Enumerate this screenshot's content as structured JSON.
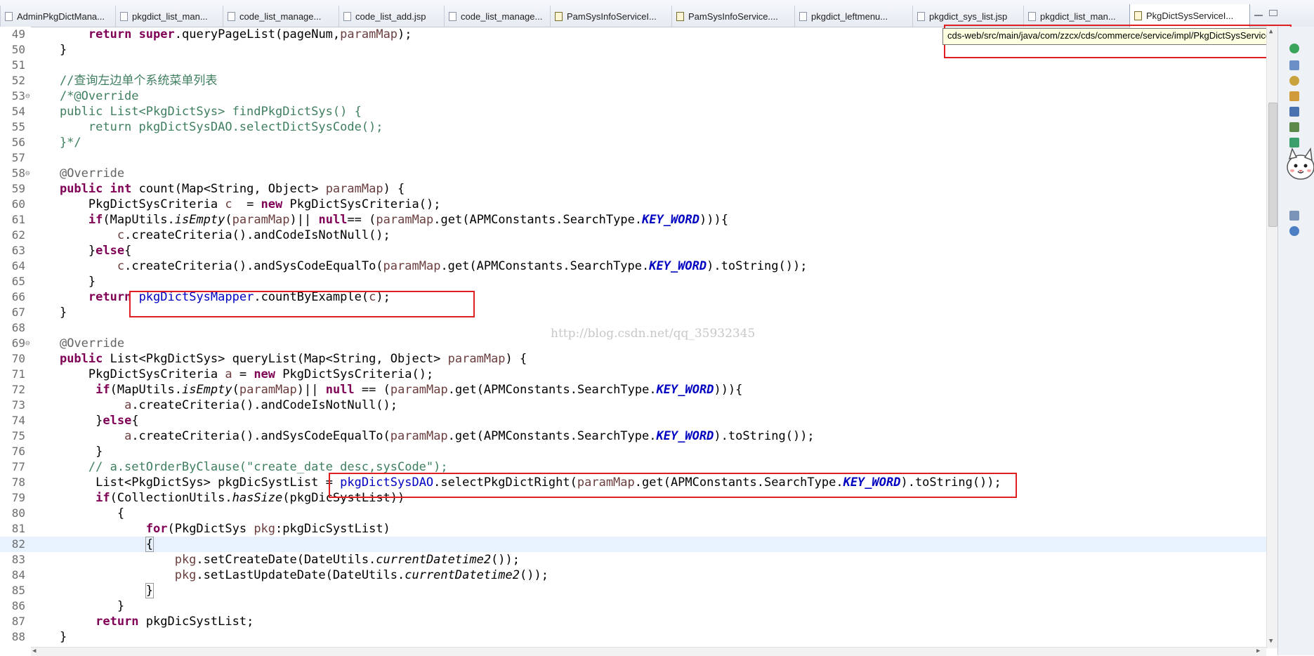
{
  "tabs": [
    {
      "label": "AdminPkgDictMana...",
      "type": "jsp"
    },
    {
      "label": "pkgdict_list_man...",
      "type": "jsp"
    },
    {
      "label": "code_list_manage...",
      "type": "jsp"
    },
    {
      "label": "code_list_add.jsp",
      "type": "jsp"
    },
    {
      "label": "code_list_manage...",
      "type": "jsp"
    },
    {
      "label": "PamSysInfoServiceI...",
      "type": "java"
    },
    {
      "label": "PamSysInfoService....",
      "type": "java"
    },
    {
      "label": "pkgdict_leftmenu...",
      "type": "jsp"
    },
    {
      "label": "pkgdict_sys_list.jsp",
      "type": "jsp"
    },
    {
      "label": "pkgdict_list_man...",
      "type": "jsp"
    },
    {
      "label": "PkgDictSysServiceI...",
      "type": "java",
      "active": true
    }
  ],
  "tooltip": "cds-web/src/main/java/com/zzcx/cds/commerce/service/impl/PkgDictSysServiceImpl.java",
  "watermark": "http://blog.csdn.net/qq_35932345",
  "current_line": 82,
  "colors": {
    "highlight_box": "#e02020",
    "keyword": "#7f0055",
    "field": "#0000c0",
    "comment": "#3f7f5f",
    "current_line_bg": "#e8f2fe"
  },
  "code_lines": [
    {
      "n": "49",
      "segs": [
        [
          "        ",
          ""
        ],
        [
          "return",
          "kw"
        ],
        [
          " ",
          ""
        ],
        [
          "super",
          "kw"
        ],
        [
          ".queryPageList(pageNum,",
          ""
        ],
        [
          "paramMap",
          "param"
        ],
        [
          ");",
          ""
        ]
      ]
    },
    {
      "n": "50",
      "segs": [
        [
          "    }",
          ""
        ]
      ]
    },
    {
      "n": "51",
      "segs": []
    },
    {
      "n": "52",
      "segs": [
        [
          "    //查询左边单个系统菜单列表",
          "cmt"
        ]
      ]
    },
    {
      "n": "53",
      "fold": true,
      "segs": [
        [
          "    /*@Override",
          "cmt"
        ]
      ]
    },
    {
      "n": "54",
      "segs": [
        [
          "    public List<PkgDictSys> findPkgDictSys() {",
          "cmt"
        ]
      ]
    },
    {
      "n": "55",
      "segs": [
        [
          "        return pkgDictSysDAO.selectDictSysCode();",
          "cmt"
        ]
      ]
    },
    {
      "n": "56",
      "segs": [
        [
          "    }*/",
          "cmt"
        ]
      ]
    },
    {
      "n": "57",
      "segs": []
    },
    {
      "n": "58",
      "fold": true,
      "segs": [
        [
          "    ",
          ""
        ],
        [
          "@Override",
          "ann"
        ]
      ]
    },
    {
      "n": "59",
      "segs": [
        [
          "    ",
          ""
        ],
        [
          "public",
          "kw"
        ],
        [
          " ",
          ""
        ],
        [
          "int",
          "kw"
        ],
        [
          " count(Map<String, Object> ",
          ""
        ],
        [
          "paramMap",
          "param"
        ],
        [
          ") {",
          ""
        ]
      ]
    },
    {
      "n": "60",
      "segs": [
        [
          "        PkgDictSysCriteria ",
          ""
        ],
        [
          "c",
          "param"
        ],
        [
          "  = ",
          ""
        ],
        [
          "new",
          "kw"
        ],
        [
          " PkgDictSysCriteria();",
          ""
        ]
      ]
    },
    {
      "n": "61",
      "segs": [
        [
          "        ",
          ""
        ],
        [
          "if",
          "kw"
        ],
        [
          "(MapUtils.",
          ""
        ],
        [
          "isEmpty",
          "static"
        ],
        [
          "(",
          ""
        ],
        [
          "paramMap",
          "param"
        ],
        [
          ")|| ",
          ""
        ],
        [
          "null",
          "kw"
        ],
        [
          "== (",
          ""
        ],
        [
          "paramMap",
          "param"
        ],
        [
          ".get(APMConstants.SearchType.",
          ""
        ],
        [
          "KEY_WORD",
          "konst"
        ],
        [
          "))){",
          ""
        ]
      ]
    },
    {
      "n": "62",
      "segs": [
        [
          "            ",
          ""
        ],
        [
          "c",
          "param"
        ],
        [
          ".createCriteria().andCodeIsNotNull();",
          ""
        ]
      ]
    },
    {
      "n": "63",
      "segs": [
        [
          "        }",
          ""
        ],
        [
          "else",
          "kw"
        ],
        [
          "{",
          ""
        ]
      ]
    },
    {
      "n": "64",
      "segs": [
        [
          "            ",
          ""
        ],
        [
          "c",
          "param"
        ],
        [
          ".createCriteria().andSysCodeEqualTo(",
          ""
        ],
        [
          "paramMap",
          "param"
        ],
        [
          ".get(APMConstants.SearchType.",
          ""
        ],
        [
          "KEY_WORD",
          "konst"
        ],
        [
          ").toString());",
          ""
        ]
      ]
    },
    {
      "n": "65",
      "segs": [
        [
          "        }",
          ""
        ]
      ]
    },
    {
      "n": "66",
      "segs": [
        [
          "        ",
          ""
        ],
        [
          "return",
          "kw"
        ],
        [
          " ",
          ""
        ],
        [
          "pkgDictSysMapper",
          "fld"
        ],
        [
          ".countByExample(",
          ""
        ],
        [
          "c",
          "param"
        ],
        [
          ");",
          ""
        ]
      ]
    },
    {
      "n": "67",
      "segs": [
        [
          "    }",
          ""
        ]
      ]
    },
    {
      "n": "68",
      "segs": []
    },
    {
      "n": "69",
      "fold": true,
      "segs": [
        [
          "    ",
          ""
        ],
        [
          "@Override",
          "ann"
        ]
      ]
    },
    {
      "n": "70",
      "segs": [
        [
          "    ",
          ""
        ],
        [
          "public",
          "kw"
        ],
        [
          " List<PkgDictSys> queryList(Map<String, Object> ",
          ""
        ],
        [
          "paramMap",
          "param"
        ],
        [
          ") {",
          ""
        ]
      ]
    },
    {
      "n": "71",
      "segs": [
        [
          "        PkgDictSysCriteria ",
          ""
        ],
        [
          "a",
          "param"
        ],
        [
          " = ",
          ""
        ],
        [
          "new",
          "kw"
        ],
        [
          " PkgDictSysCriteria();",
          ""
        ]
      ]
    },
    {
      "n": "72",
      "segs": [
        [
          "         ",
          ""
        ],
        [
          "if",
          "kw"
        ],
        [
          "(MapUtils.",
          ""
        ],
        [
          "isEmpty",
          "static"
        ],
        [
          "(",
          ""
        ],
        [
          "paramMap",
          "param"
        ],
        [
          ")|| ",
          ""
        ],
        [
          "null",
          "kw"
        ],
        [
          " == (",
          ""
        ],
        [
          "paramMap",
          "param"
        ],
        [
          ".get(APMConstants.SearchType.",
          ""
        ],
        [
          "KEY_WORD",
          "konst"
        ],
        [
          "))){",
          ""
        ]
      ]
    },
    {
      "n": "73",
      "segs": [
        [
          "             ",
          ""
        ],
        [
          "a",
          "param"
        ],
        [
          ".createCriteria().andCodeIsNotNull();",
          ""
        ]
      ]
    },
    {
      "n": "74",
      "segs": [
        [
          "         }",
          ""
        ],
        [
          "else",
          "kw"
        ],
        [
          "{",
          ""
        ]
      ]
    },
    {
      "n": "75",
      "segs": [
        [
          "             ",
          ""
        ],
        [
          "a",
          "param"
        ],
        [
          ".createCriteria().andSysCodeEqualTo(",
          ""
        ],
        [
          "paramMap",
          "param"
        ],
        [
          ".get(APMConstants.SearchType.",
          ""
        ],
        [
          "KEY_WORD",
          "konst"
        ],
        [
          ").toString());",
          ""
        ]
      ]
    },
    {
      "n": "76",
      "segs": [
        [
          "         }",
          ""
        ]
      ]
    },
    {
      "n": "77",
      "segs": [
        [
          "        // a.setOrderByClause(\"create_date desc,sysCode\");",
          "cmt"
        ]
      ]
    },
    {
      "n": "78",
      "segs": [
        [
          "         List<PkgDictSys> pkgDicSystList = ",
          ""
        ],
        [
          "pkgDictSysDAO",
          "fld"
        ],
        [
          ".selectPkgDictRight(",
          ""
        ],
        [
          "paramMap",
          "param"
        ],
        [
          ".get(APMConstants.SearchType.",
          ""
        ],
        [
          "KEY_WORD",
          "konst"
        ],
        [
          ").toString());",
          ""
        ]
      ]
    },
    {
      "n": "79",
      "segs": [
        [
          "         ",
          ""
        ],
        [
          "if",
          "kw"
        ],
        [
          "(CollectionUtils.",
          ""
        ],
        [
          "hasSize",
          "static"
        ],
        [
          "(pkgDicSystList))",
          ""
        ]
      ]
    },
    {
      "n": "80",
      "segs": [
        [
          "            {",
          ""
        ]
      ]
    },
    {
      "n": "81",
      "segs": [
        [
          "                ",
          ""
        ],
        [
          "for",
          "kw"
        ],
        [
          "(PkgDictSys ",
          ""
        ],
        [
          "pkg",
          "param"
        ],
        [
          ":pkgDicSystList)",
          ""
        ]
      ]
    },
    {
      "n": "82",
      "segs": [
        [
          "                ",
          ""
        ],
        [
          "{",
          "bracket"
        ],
        [
          "",
          "caret"
        ]
      ]
    },
    {
      "n": "83",
      "segs": [
        [
          "                    ",
          ""
        ],
        [
          "pkg",
          "param"
        ],
        [
          ".setCreateDate(DateUtils.",
          ""
        ],
        [
          "currentDatetime2",
          "static"
        ],
        [
          "());",
          ""
        ]
      ]
    },
    {
      "n": "84",
      "segs": [
        [
          "                    ",
          ""
        ],
        [
          "pkg",
          "param"
        ],
        [
          ".setLastUpdateDate(DateUtils.",
          ""
        ],
        [
          "currentDatetime2",
          "static"
        ],
        [
          "());",
          ""
        ]
      ]
    },
    {
      "n": "85",
      "segs": [
        [
          "                ",
          ""
        ],
        [
          "}",
          "bracket"
        ]
      ]
    },
    {
      "n": "86",
      "segs": [
        [
          "            }",
          ""
        ]
      ]
    },
    {
      "n": "87",
      "segs": [
        [
          "         ",
          ""
        ],
        [
          "return",
          "kw"
        ],
        [
          " pkgDicSystList;",
          ""
        ]
      ]
    },
    {
      "n": "88",
      "segs": [
        [
          "    }",
          ""
        ]
      ]
    }
  ]
}
